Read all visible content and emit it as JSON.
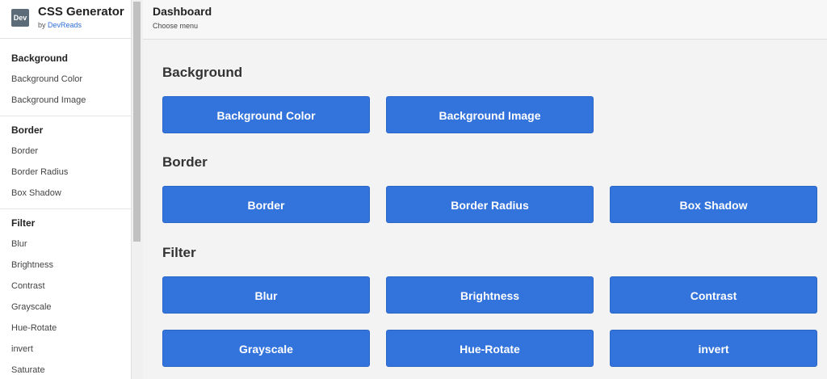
{
  "brand": {
    "logo_text": "Dev",
    "title": "CSS Generator",
    "by_prefix": "by",
    "by_link": "DevReads"
  },
  "sidebar": {
    "groups": [
      {
        "heading": "Background",
        "items": [
          "Background Color",
          "Background Image"
        ]
      },
      {
        "heading": "Border",
        "items": [
          "Border",
          "Border Radius",
          "Box Shadow"
        ]
      },
      {
        "heading": "Filter",
        "items": [
          "Blur",
          "Brightness",
          "Contrast",
          "Grayscale",
          "Hue-Rotate",
          "invert",
          "Saturate"
        ]
      }
    ]
  },
  "header": {
    "title": "Dashboard",
    "subtitle": "Choose menu"
  },
  "main": {
    "sections": [
      {
        "title": "Background",
        "buttons": [
          "Background Color",
          "Background Image"
        ]
      },
      {
        "title": "Border",
        "buttons": [
          "Border",
          "Border Radius",
          "Box Shadow"
        ]
      },
      {
        "title": "Filter",
        "buttons": [
          "Blur",
          "Brightness",
          "Contrast",
          "Grayscale",
          "Hue-Rotate",
          "invert"
        ]
      }
    ]
  },
  "colors": {
    "accent": "#3273dc",
    "link": "#2e6fd6",
    "logo_bg": "#5b6b78"
  }
}
